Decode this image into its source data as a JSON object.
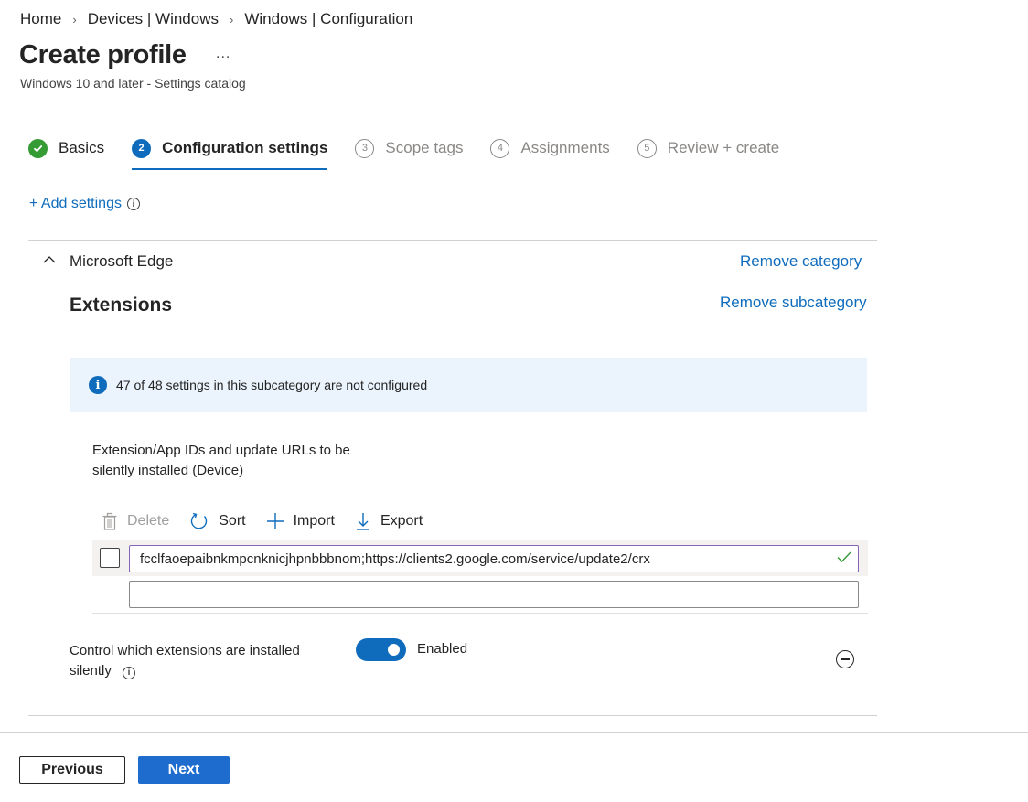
{
  "breadcrumb": [
    "Home",
    "Devices | Windows",
    "Windows | Configuration"
  ],
  "page": {
    "title": "Create profile",
    "more": "...",
    "subtitle": "Windows 10 and later - Settings catalog"
  },
  "steps": [
    {
      "number": "1",
      "label": "Basics",
      "state": "done"
    },
    {
      "number": "2",
      "label": "Configuration settings",
      "state": "active"
    },
    {
      "number": "3",
      "label": "Scope tags",
      "state": "pending"
    },
    {
      "number": "4",
      "label": "Assignments",
      "state": "pending"
    },
    {
      "number": "5",
      "label": "Review + create",
      "state": "pending"
    }
  ],
  "add_settings": {
    "label": "+ Add settings",
    "info": "i"
  },
  "category": {
    "name": "Microsoft Edge",
    "remove_label": "Remove category",
    "subcategory": {
      "name": "Extensions",
      "remove_label": "Remove subcategory",
      "info_icon": "i",
      "info_text": "47 of 48 settings in this subcategory are not configured"
    }
  },
  "list_setting": {
    "label": "Extension/App IDs and update URLs to be silently installed (Device)",
    "toolbar": {
      "delete": "Delete",
      "sort": "Sort",
      "import": "Import",
      "export": "Export"
    },
    "rows": [
      {
        "value": "fcclfaoepaibnkmpcnknicjhpnbbbnom;https://clients2.google.com/service/update2/crx",
        "valid": true
      }
    ],
    "new_row_value": ""
  },
  "toggle_setting": {
    "label": "Control which extensions are installed silently",
    "info": "i",
    "state_label": "Enabled",
    "enabled": true
  },
  "footer": {
    "previous": "Previous",
    "next": "Next"
  },
  "colors": {
    "accent": "#0f6cbd",
    "success": "#359b35",
    "info_bg": "#ebf3fc",
    "primary_button": "#1f6ccf"
  }
}
